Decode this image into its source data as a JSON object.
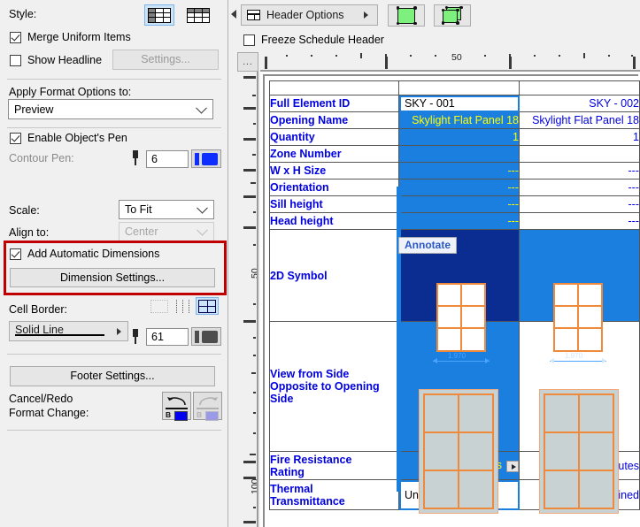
{
  "left_panel": {
    "style_label": "Style:",
    "style_options": [
      "merged-grid-style",
      "plain-grid-style"
    ],
    "style_selected_index": 0,
    "merge_uniform_items": {
      "label": "Merge Uniform Items",
      "checked": true
    },
    "show_headline": {
      "label": "Show Headline",
      "checked": false
    },
    "headline_settings_button": "Settings...",
    "apply_format_label": "Apply Format Options to:",
    "apply_format_value": "Preview",
    "enable_object_pen": {
      "label": "Enable Object's Pen",
      "checked": true
    },
    "contour_pen_label": "Contour Pen:",
    "contour_pen_value": "6",
    "contour_pen_color": "#0d2eff",
    "scale_label": "Scale:",
    "scale_value": "To Fit",
    "align_label": "Align to:",
    "align_value": "Center",
    "add_automatic_dimensions": {
      "label": "Add Automatic Dimensions",
      "checked": true
    },
    "dimension_settings_button": "Dimension Settings...",
    "highlight_color": "#c00000",
    "cell_border_label": "Cell Border:",
    "cell_border_options": [
      "no-border",
      "vertical-border",
      "full-grid-border"
    ],
    "cell_border_selected_index": 2,
    "line_type_value": "Solid Line",
    "border_pen_value": "61",
    "border_pen_color": "#4d4d4d",
    "footer_settings_button": "Footer Settings...",
    "cancel_redo_label_line1": "Cancel/Redo",
    "cancel_redo_label_line2": "Format Change:",
    "undo_bi": "B I",
    "redo_bi": "B I"
  },
  "toolbar": {
    "header_options_button": "Header Options",
    "view_2d_button": "2d-view-toggle",
    "view_3d_button": "3d-view-toggle",
    "freeze_schedule_header": {
      "label": "Freeze Schedule Header",
      "checked": false
    }
  },
  "rulers": {
    "corner_label": "...",
    "horizontal_labels": [
      "50"
    ],
    "vertical_labels": [
      "50",
      "100"
    ]
  },
  "schedule": {
    "columns": [
      "",
      "SKY - 001",
      "SKY - 002"
    ],
    "rows": [
      {
        "field": "Full Element ID",
        "a": "SKY - 001",
        "b": "SKY - 002",
        "a_state": "editing"
      },
      {
        "field": "Opening Name",
        "a": "Skylight Flat Panel 18",
        "b": "Skylight Flat Panel 18",
        "a_state": "selected"
      },
      {
        "field": "Quantity",
        "a": "1",
        "b": "1",
        "a_state": "selected"
      },
      {
        "field": "Zone Number",
        "a": "",
        "b": "",
        "a_state": "selected"
      },
      {
        "field": "W x H Size",
        "a": "---",
        "b": "---",
        "a_state": "selected"
      },
      {
        "field": "Orientation",
        "a": "---",
        "b": "---",
        "a_state": "selected"
      },
      {
        "field": "Sill height",
        "a": "---",
        "b": "---",
        "a_state": "selected"
      },
      {
        "field": "Head height",
        "a": "---",
        "b": "---",
        "a_state": "selected"
      }
    ],
    "symbol_row": {
      "field": "2D Symbol",
      "a_dimension": "1.970",
      "b_dimension": "1.970",
      "a_state": "active"
    },
    "view_row": {
      "field": "View from Side Opposite to Opening Side",
      "a_state": "selected"
    },
    "fire_row": {
      "field": "Fire Resistance Rating",
      "a": "25 minutes",
      "b": "25 minutes",
      "a_state": "selected"
    },
    "thermal_row": {
      "field": "Thermal Transmittance",
      "a": "Undefined",
      "b": "Undefined",
      "a_state": "editing"
    }
  },
  "tooltip": {
    "annotate_label": "Annotate"
  }
}
